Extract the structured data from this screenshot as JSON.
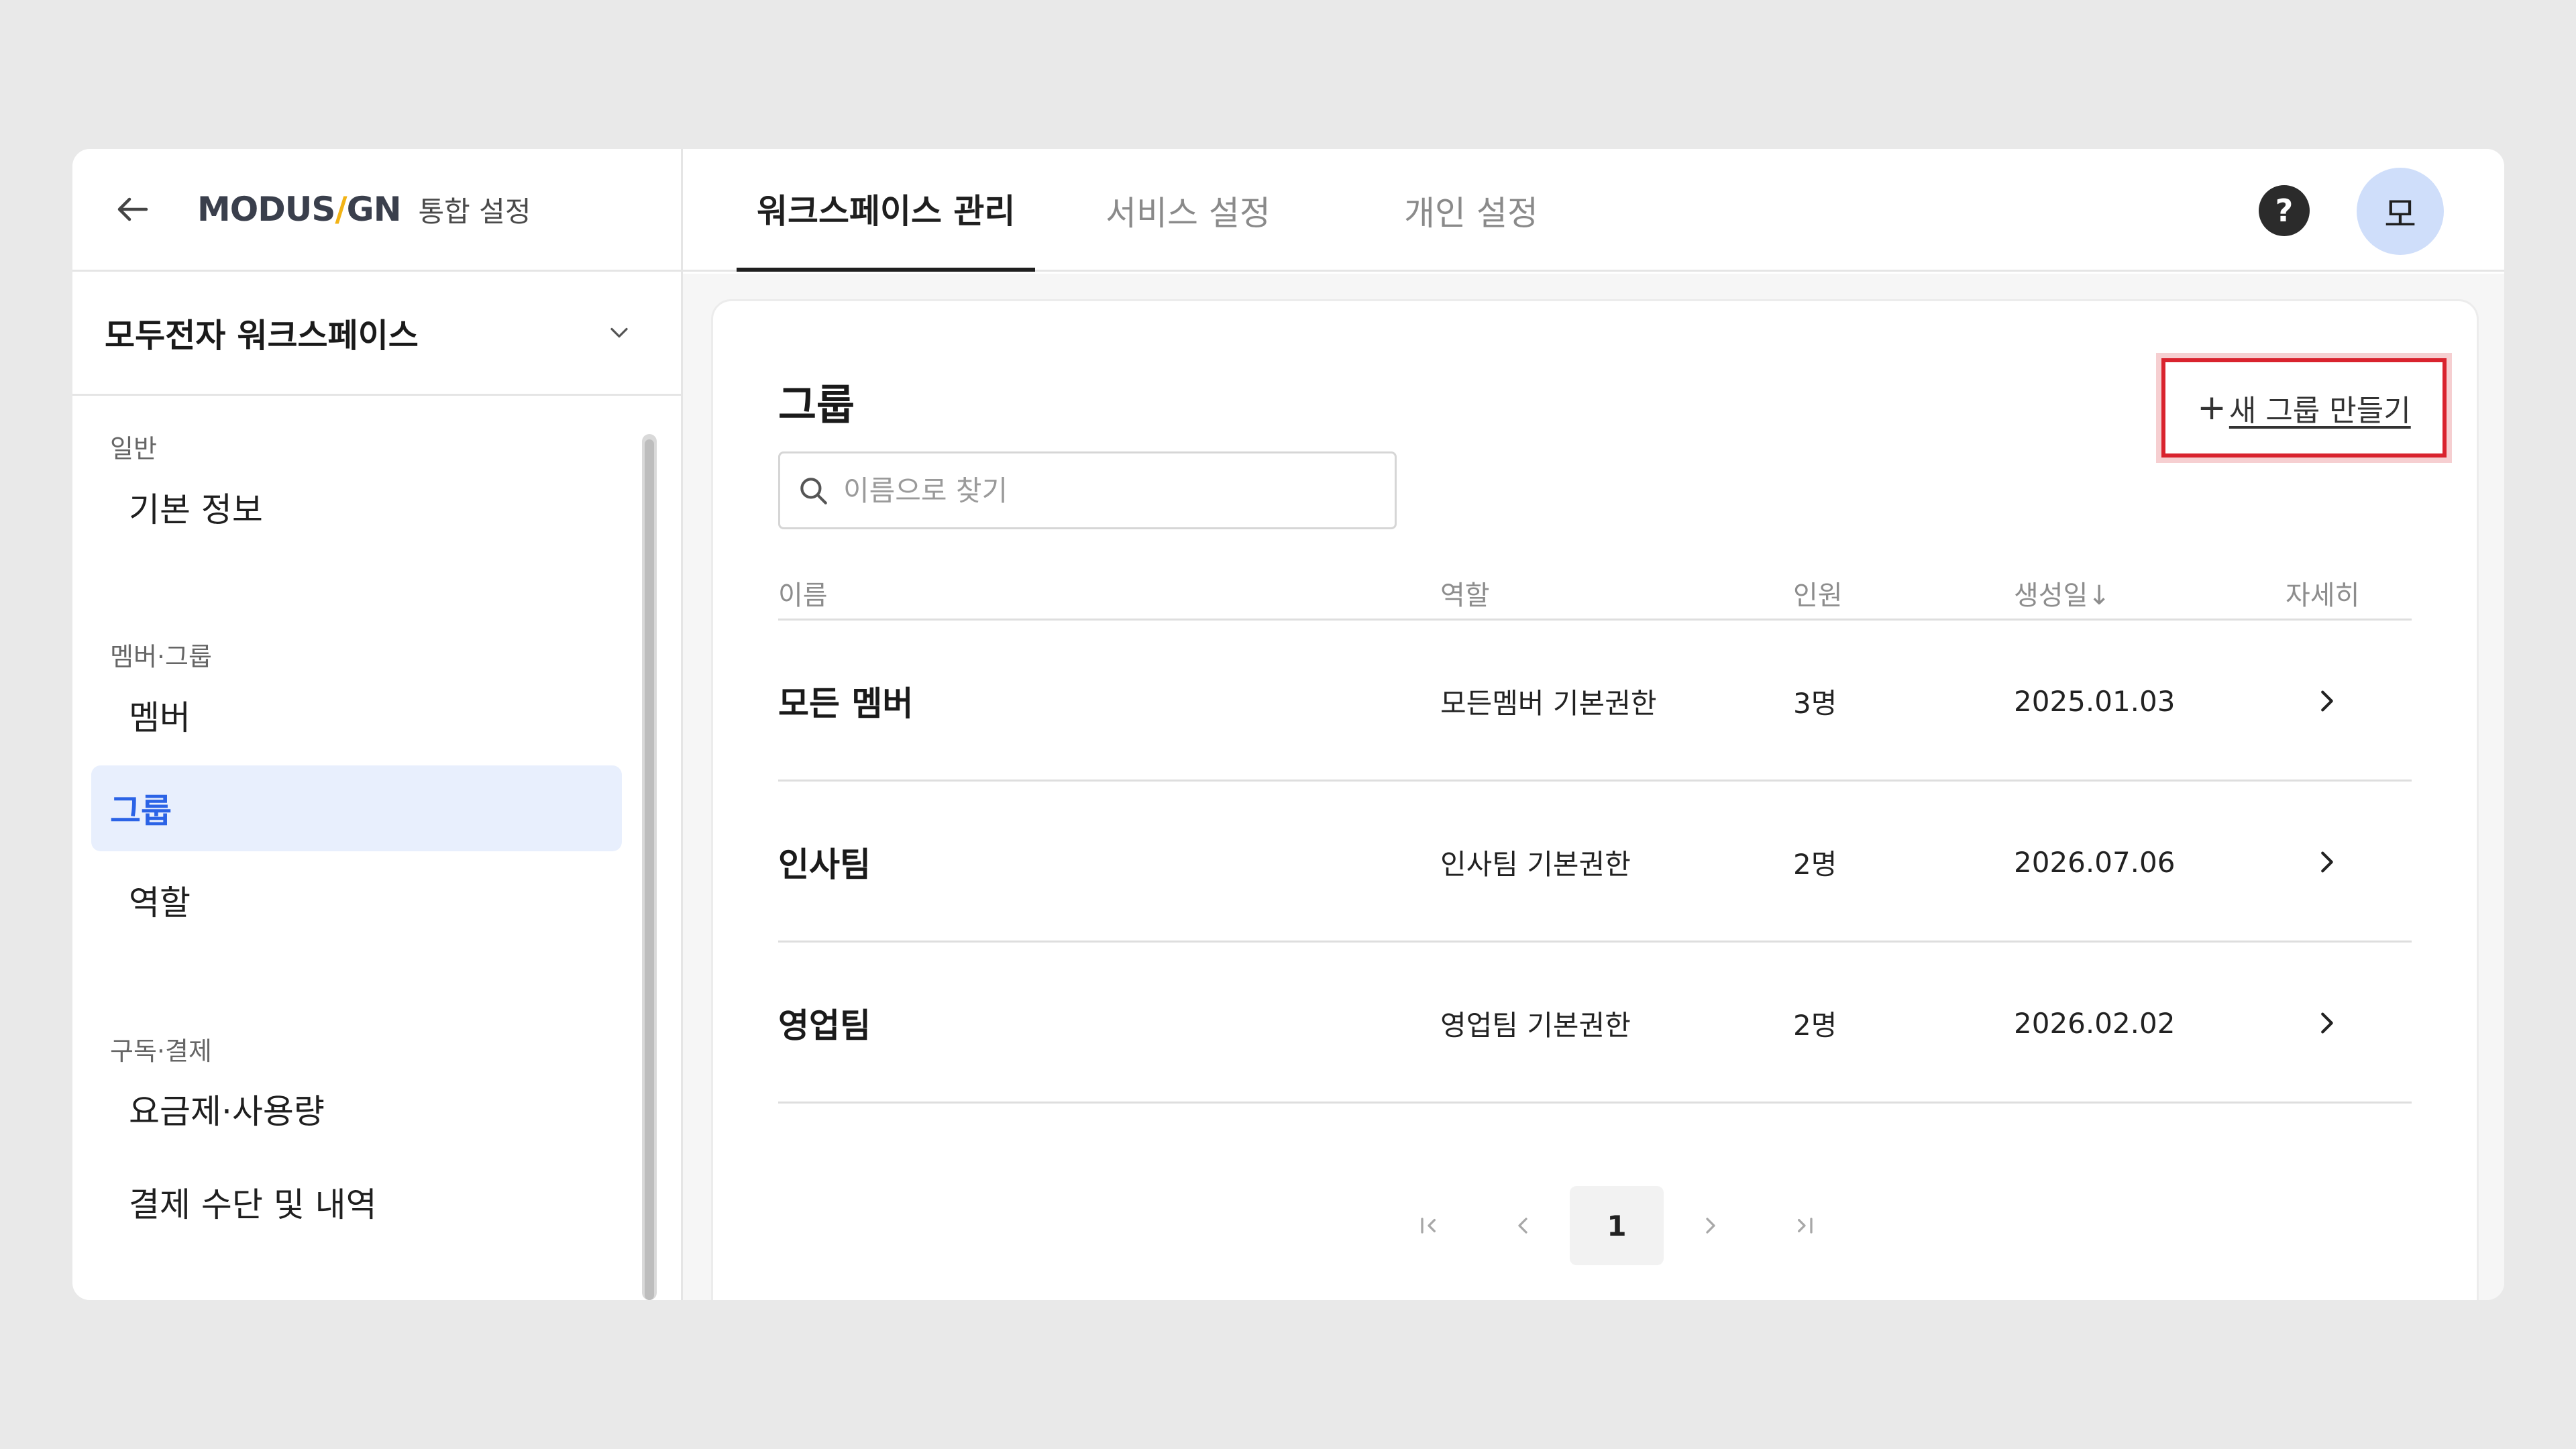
{
  "brand": {
    "logo_left": "MODUS",
    "logo_slash": "/",
    "logo_right": "GN",
    "subtitle": "통합 설정"
  },
  "workspace": {
    "name": "모두전자 워크스페이스"
  },
  "sidebar": {
    "sections": [
      {
        "title": "일반",
        "items": [
          {
            "label": "기본 정보",
            "active": false
          }
        ]
      },
      {
        "title": "멤버·그룹",
        "items": [
          {
            "label": "멤버",
            "active": false
          },
          {
            "label": "그룹",
            "active": true
          },
          {
            "label": "역할",
            "active": false
          }
        ]
      },
      {
        "title": "구독·결제",
        "items": [
          {
            "label": "요금제·사용량",
            "active": false
          },
          {
            "label": "결제 수단 및 내역",
            "active": false
          }
        ]
      }
    ]
  },
  "tabs": [
    {
      "label": "워크스페이스 관리",
      "active": true
    },
    {
      "label": "서비스 설정",
      "active": false
    },
    {
      "label": "개인 설정",
      "active": false
    }
  ],
  "header": {
    "help_label": "?",
    "avatar_initial": "모"
  },
  "main": {
    "title": "그룹",
    "create_button": {
      "plus": "+",
      "label": "새 그룹 만들기"
    },
    "search": {
      "placeholder": "이름으로 찾기",
      "value": ""
    },
    "columns": [
      "이름",
      "역할",
      "인원",
      "생성일↓",
      "자세히"
    ],
    "rows": [
      {
        "name": "모든 멤버",
        "role": "모든멤버 기본권한",
        "count": "3명",
        "created": "2025.01.03"
      },
      {
        "name": "인사팀",
        "role": "인사팀 기본권한",
        "count": "2명",
        "created": "2026.07.06"
      },
      {
        "name": "영업팀",
        "role": "영업팀 기본권한",
        "count": "2명",
        "created": "2026.02.02"
      }
    ],
    "pagination": {
      "current_page": "1"
    }
  },
  "colors": {
    "accent": "#2b63e6",
    "active_bg": "#e8effd",
    "highlight": "#d9232e",
    "avatar_bg": "#cfdefa",
    "logo_slash": "#f2b315"
  }
}
